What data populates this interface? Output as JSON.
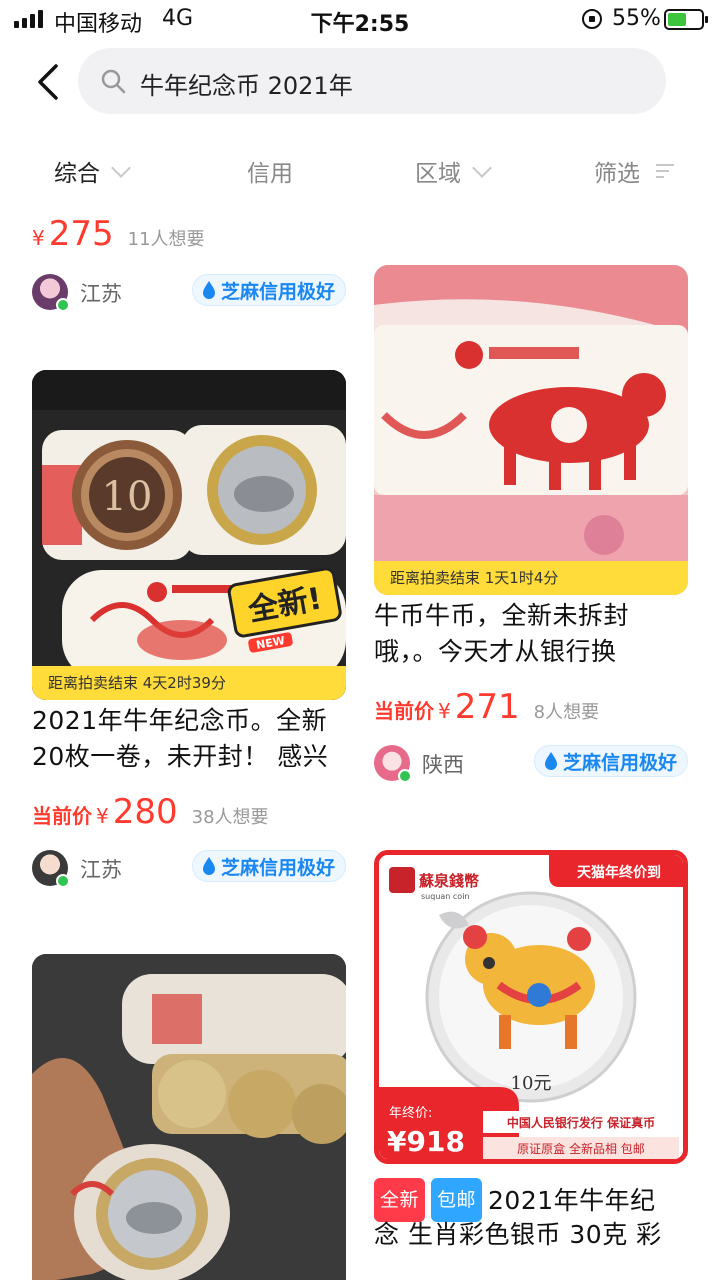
{
  "status_bar": {
    "carrier": "中国移动",
    "network": "4G",
    "time": "下午2:55",
    "battery_percent": "55%",
    "battery_level": 0.55
  },
  "search": {
    "query": "牛年纪念币 2021年"
  },
  "filters": [
    {
      "label": "综合"
    },
    {
      "label": "信用"
    },
    {
      "label": "区域"
    },
    {
      "label": "筛选"
    }
  ],
  "items": {
    "top_left": {
      "price_yen": "¥",
      "price": "275",
      "want": "11人想要",
      "region": "江苏",
      "credit": "芝麻信用极好"
    },
    "left_1": {
      "auction_text": "距离拍卖结束 4天2时39分",
      "title_line1": "2021年牛年纪念币。全新",
      "title_line2": "20枚一卷，未开封！ 感兴",
      "price_label": "当前价",
      "price_yen": "¥",
      "price": "280",
      "want": "38人想要",
      "region": "江苏",
      "credit": "芝麻信用极好",
      "image_badge": "全新!",
      "image_badge_sub": "NEW"
    },
    "right_1": {
      "auction_text": "距离拍卖结束 1天1时4分",
      "title_line1": "牛币牛币，全新未拆封",
      "title_line2": "哦，。今天才从银行换",
      "price_label": "当前价",
      "price_yen": "¥",
      "price": "271",
      "want": "8人想要",
      "region": "陕西",
      "credit": "芝麻信用极好"
    },
    "right_2": {
      "tag_new": "全新",
      "tag_ship": "包邮",
      "title_line1": "2021年牛年纪",
      "title_line2": "念 生肖彩色银币 30克 彩",
      "img_brand": "蘇泉錢幣",
      "img_brand_en": "suquan coin",
      "img_promo": "天猫年终价到",
      "img_year_label": "年终价:",
      "img_price": "¥918",
      "img_coin_value": "10元",
      "img_line1": "中国人民银行发行 保证真币",
      "img_line2": "原证原盒 全新品相 包邮"
    }
  },
  "colors": {
    "price_red": "#ff3b30",
    "auction_yellow": "#ffdc3a",
    "credit_blue": "#1a88f0",
    "online_green": "#31c451"
  }
}
